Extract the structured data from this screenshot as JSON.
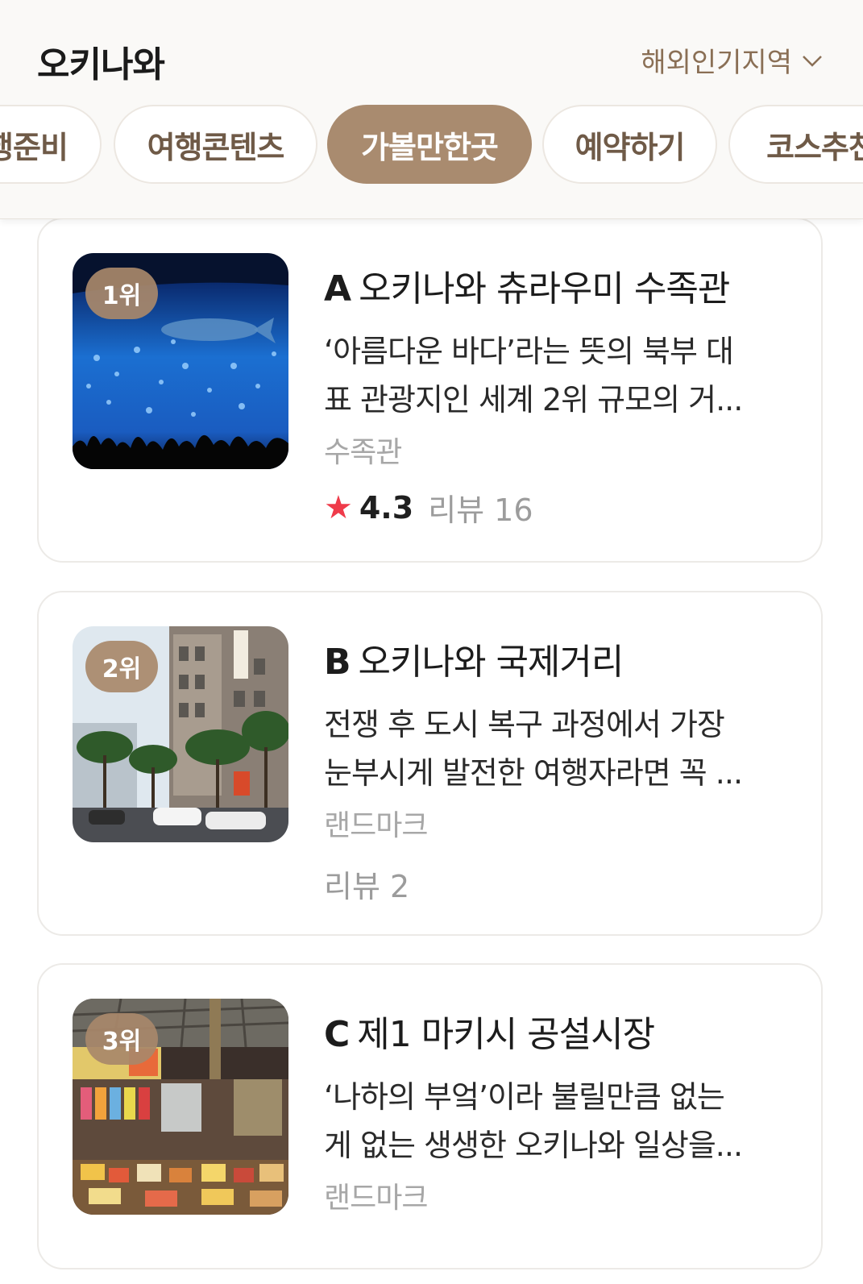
{
  "header": {
    "city": "오키나와",
    "region_select": "해외인기지역"
  },
  "tabs": [
    "행준비",
    "여행콘텐츠",
    "가볼만한곳",
    "예약하기",
    "코스추천"
  ],
  "active_tab": "가볼만한곳",
  "places": [
    {
      "rank": "1위",
      "letter": "A",
      "name": "오키나와 츄라우미 수족관",
      "desc_line1": "‘아름다운 바다’라는 뜻의 북부 대",
      "desc_line2": "표 관광지인 세계 2위 규모의 거...",
      "category": "수족관",
      "star": "★",
      "score": "4.3",
      "reviews": "리뷰 16"
    },
    {
      "rank": "2위",
      "letter": "B",
      "name": "오키나와 국제거리",
      "desc_line1": "전쟁 후 도시 복구 과정에서 가장",
      "desc_line2": "눈부시게 발전한 여행자라면 꼭 ...",
      "category": "랜드마크",
      "reviews": "리뷰 2"
    },
    {
      "rank": "3위",
      "letter": "C",
      "name": "제1 마키시 공설시장",
      "desc_line1": "‘나하의 부엌’이라 불릴만큼 없는",
      "desc_line2": "게 없는 생생한 오키나와 일상을...",
      "category": "랜드마크"
    }
  ],
  "colors": {
    "accent": "#a98b6f",
    "tab_text": "#6f5a47",
    "star": "#ef3b4a"
  }
}
